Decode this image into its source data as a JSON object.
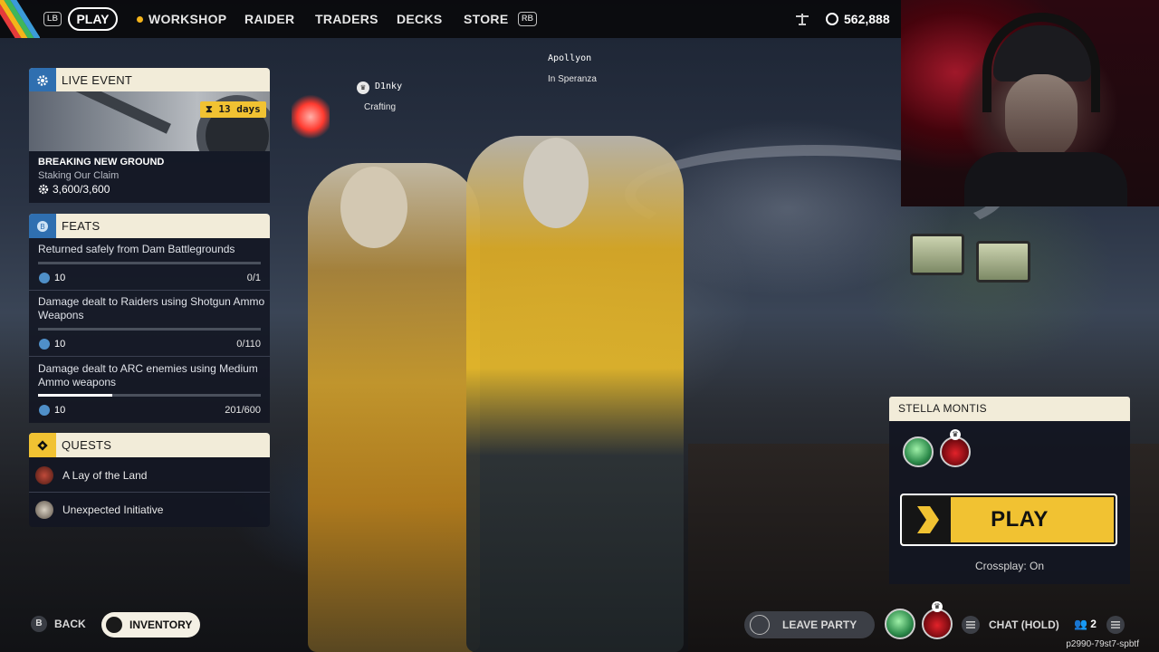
{
  "topnav": {
    "lb": "LB",
    "rb": "RB",
    "items": [
      {
        "label": "PLAY",
        "active": true
      },
      {
        "label": "WORKSHOP"
      },
      {
        "label": "RAIDER"
      },
      {
        "label": "TRADERS"
      },
      {
        "label": "DECKS"
      },
      {
        "label": "STORE"
      }
    ],
    "currency": "562,888"
  },
  "live_event": {
    "header": "LIVE EVENT",
    "days_badge": "13 days",
    "title": "BREAKING NEW GROUND",
    "subtitle": "Staking Our Claim",
    "progress": "3,600/3,600"
  },
  "feats": {
    "header": "FEATS",
    "items": [
      {
        "title": "Returned safely from Dam Battlegrounds",
        "reward": "10",
        "progress": "0/1",
        "fraction": 0
      },
      {
        "title": "Damage dealt to Raiders using Shotgun Ammo Weapons",
        "reward": "10",
        "progress": "0/110",
        "fraction": 0
      },
      {
        "title": "Damage dealt to ARC enemies using Medium Ammo weapons",
        "reward": "10",
        "progress": "201/600",
        "fraction": 0.335
      }
    ]
  },
  "quests": {
    "header": "QUESTS",
    "items": [
      {
        "label": "A Lay of the Land"
      },
      {
        "label": "Unexpected Initiative"
      }
    ]
  },
  "players": [
    {
      "name": "D1nky",
      "status": "Crafting"
    },
    {
      "name": "Apollyon",
      "status": "In Speranza"
    }
  ],
  "play_card": {
    "map": "STELLA MONTIS",
    "play_label": "PLAY",
    "crossplay": "Crossplay: On"
  },
  "bottom": {
    "back_key": "B",
    "back_label": "BACK",
    "inventory_label": "INVENTORY",
    "leave_party_label": "LEAVE PARTY",
    "chat_label": "CHAT (HOLD)",
    "party_count": "2",
    "session_code": "p2990-79st7-spbtf"
  },
  "colors": {
    "accent_yellow": "#f1c232",
    "panel_header": "#f2ecd9",
    "panel_bg": "#121622",
    "feat_coin": "#4f8fc8"
  }
}
